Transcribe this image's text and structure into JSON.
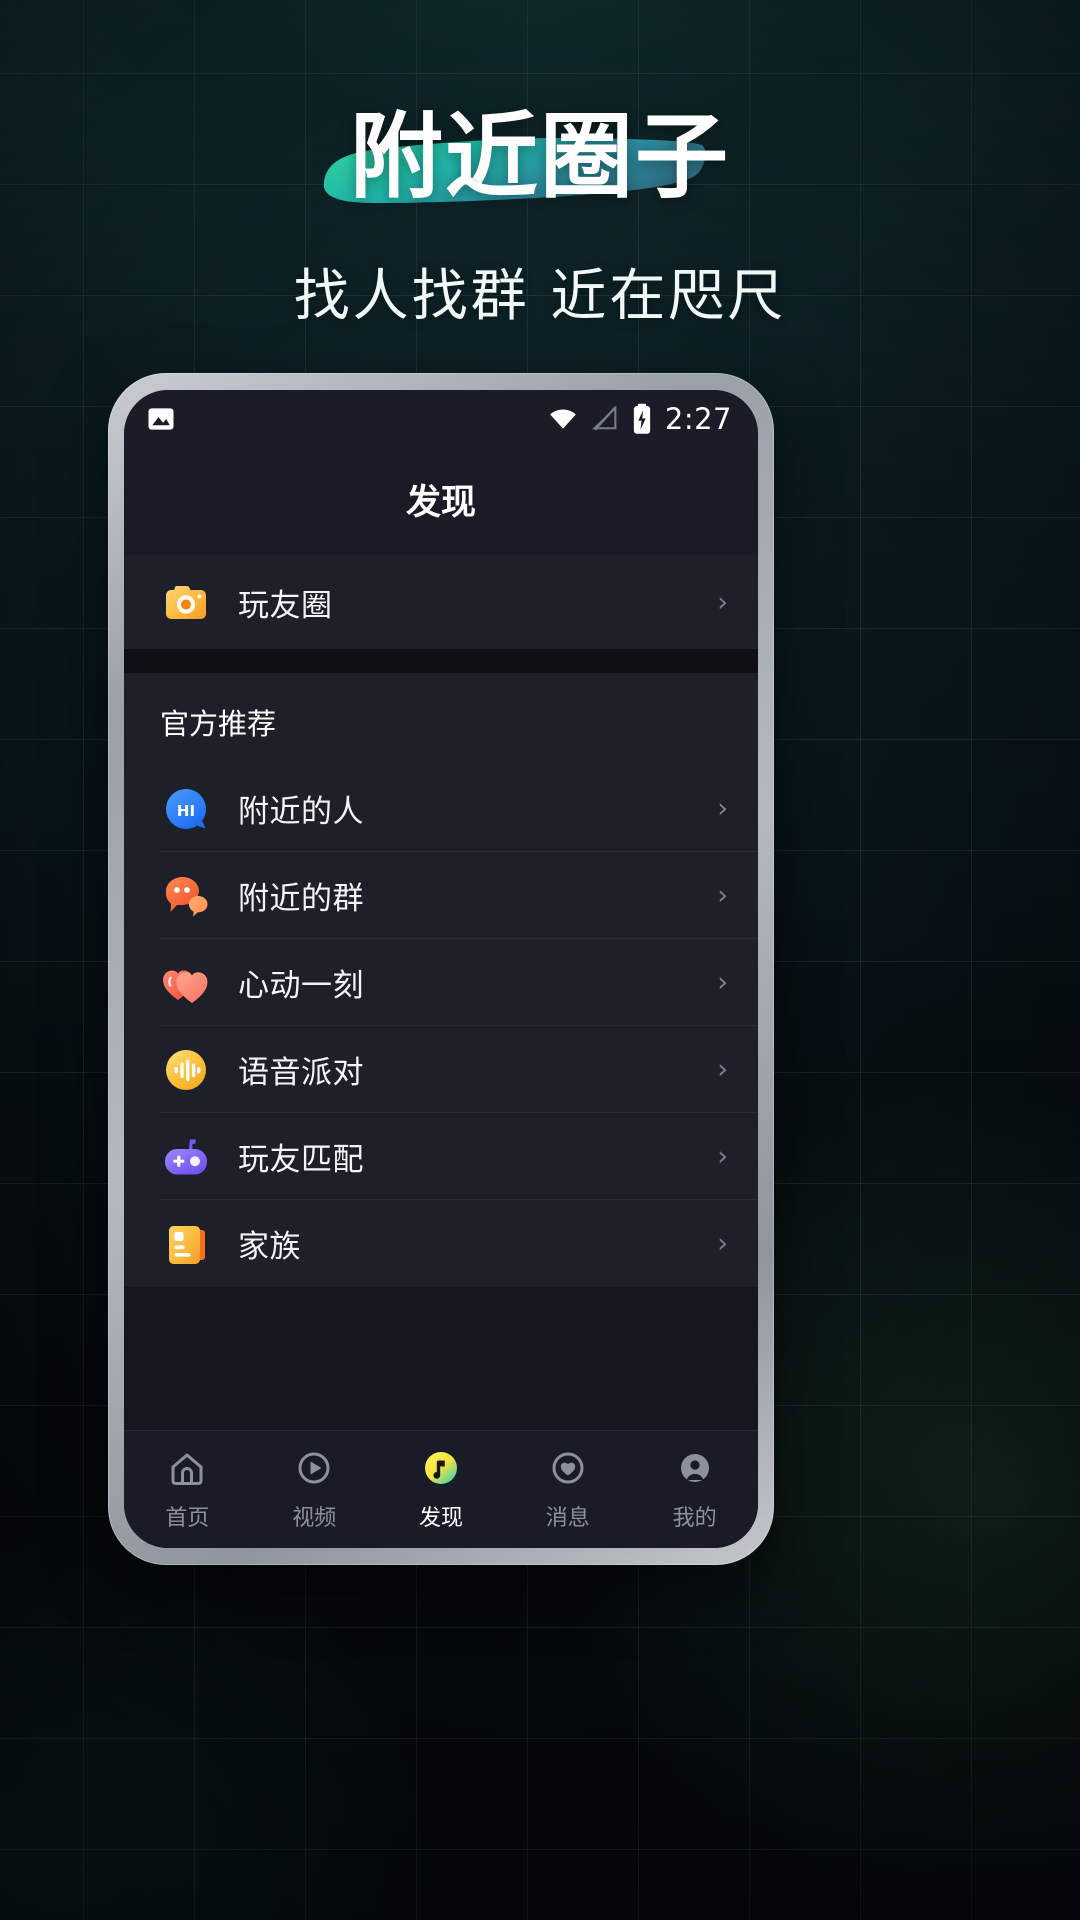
{
  "hero": {
    "title": "附近圈子",
    "subtitle": "找人找群 近在咫尺",
    "brush_color_start": "#2fd09a",
    "brush_color_end": "#2c7f93",
    "title_color": "#ffffff"
  },
  "statusbar": {
    "gallery_icon": "image-icon",
    "wifi_icon": "wifi-icon",
    "signal_icon": "signal-off-icon",
    "battery_icon": "battery-charging-icon",
    "time": "2:27"
  },
  "screen": {
    "page_title": "发现",
    "top_card": {
      "items": [
        {
          "label": "玩友圈",
          "icon": "camera-icon",
          "chevron": "›"
        }
      ]
    },
    "section": {
      "title": "官方推荐",
      "items": [
        {
          "label": "附近的人",
          "icon": "hi-bubble-icon",
          "chevron": "›"
        },
        {
          "label": "附近的群",
          "icon": "chat-bubbles-icon",
          "chevron": "›"
        },
        {
          "label": "心动一刻",
          "icon": "hearts-icon",
          "chevron": "›"
        },
        {
          "label": "语音派对",
          "icon": "voice-wave-icon",
          "chevron": "›"
        },
        {
          "label": "玩友匹配",
          "icon": "gamepad-icon",
          "chevron": "›"
        },
        {
          "label": "家族",
          "icon": "family-card-icon",
          "chevron": "›"
        }
      ]
    },
    "tabbar": {
      "active_index": 2,
      "active_color": "#f6e14a",
      "inactive_color": "#8d919c",
      "tabs": [
        {
          "label": "首页",
          "icon": "home-icon"
        },
        {
          "label": "视频",
          "icon": "play-circle-icon"
        },
        {
          "label": "发现",
          "icon": "discover-icon"
        },
        {
          "label": "消息",
          "icon": "message-heart-icon"
        },
        {
          "label": "我的",
          "icon": "profile-icon"
        }
      ]
    }
  }
}
